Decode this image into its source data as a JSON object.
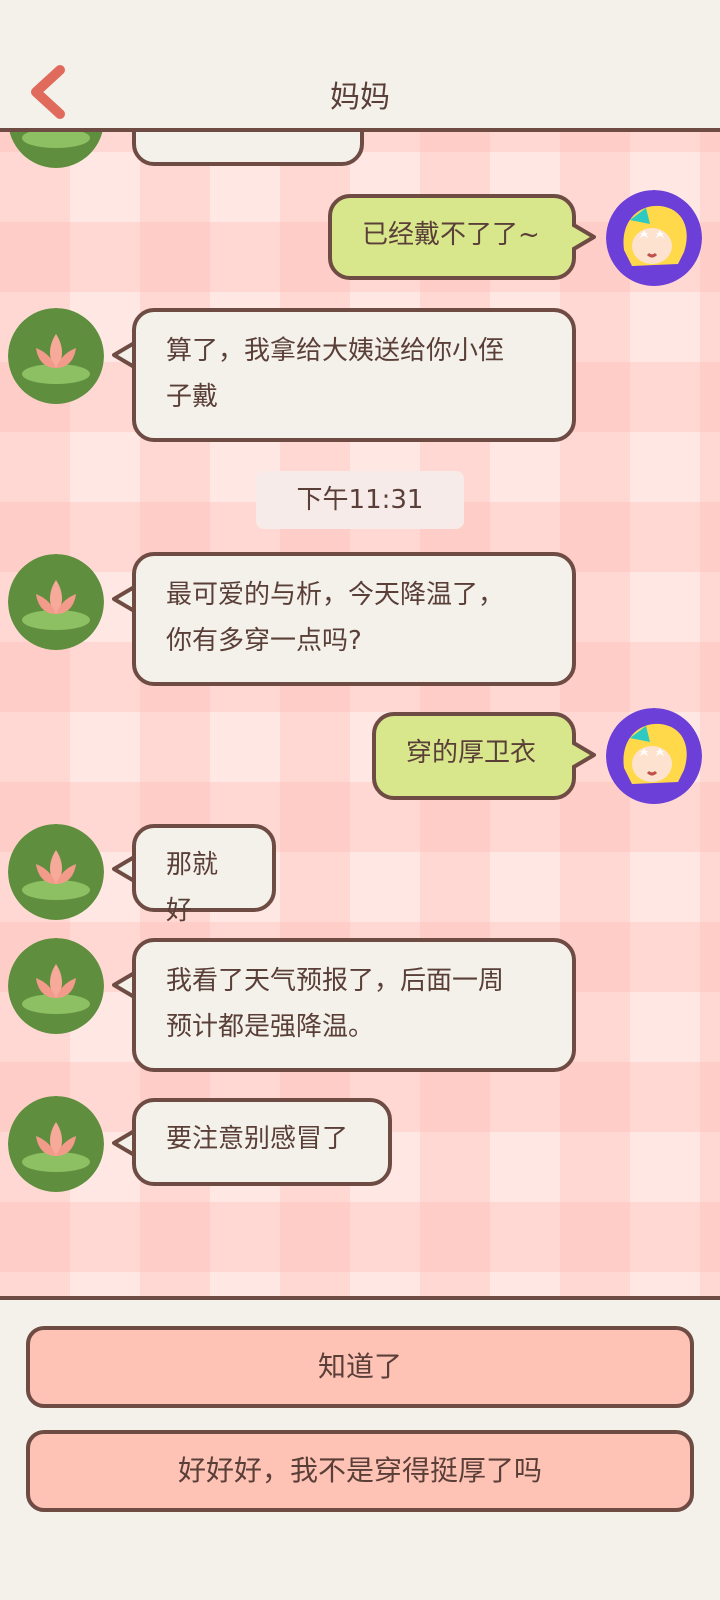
{
  "header": {
    "title": "妈妈"
  },
  "messages": [
    {
      "side": "left",
      "text": ""
    },
    {
      "side": "right",
      "text": "已经戴不了了~"
    },
    {
      "side": "left",
      "lines": [
        "算了，我拿给大姨送给你小侄",
        "子戴"
      ]
    },
    {
      "type": "time",
      "text": "下午11:31"
    },
    {
      "side": "left",
      "lines": [
        "最可爱的与析，今天降温了，",
        "你有多穿一点吗?"
      ]
    },
    {
      "side": "right",
      "text": "穿的厚卫衣"
    },
    {
      "side": "left",
      "text": "那就好"
    },
    {
      "side": "left",
      "lines": [
        "我看了天气预报了，后面一周",
        "预计都是强降温。"
      ]
    },
    {
      "side": "left",
      "text": "要注意别感冒了"
    }
  ],
  "replies": [
    "知道了",
    "好好好，我不是穿得挺厚了吗"
  ],
  "icons": {
    "back": "chevron-left-icon",
    "mom_avatar": "lotus-avatar",
    "me_avatar": "girl-avatar"
  },
  "colors": {
    "accent": "#e06b5c",
    "bubble_me": "#d8e68c",
    "bubble_other": "#f4f1eb",
    "border": "#6e4b43",
    "reply_button": "#ffc3b6"
  }
}
